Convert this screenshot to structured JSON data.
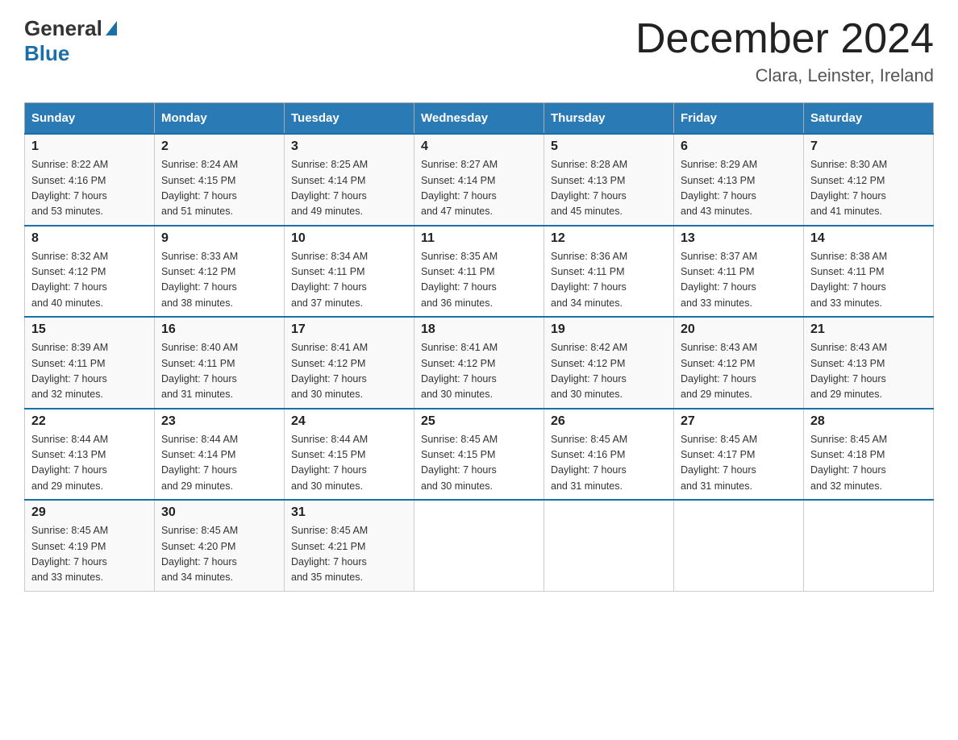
{
  "header": {
    "logo_general": "General",
    "logo_blue": "Blue",
    "month_title": "December 2024",
    "location": "Clara, Leinster, Ireland"
  },
  "days_of_week": [
    "Sunday",
    "Monday",
    "Tuesday",
    "Wednesday",
    "Thursday",
    "Friday",
    "Saturday"
  ],
  "weeks": [
    [
      {
        "day": "1",
        "sunrise": "8:22 AM",
        "sunset": "4:16 PM",
        "daylight": "7 hours and 53 minutes."
      },
      {
        "day": "2",
        "sunrise": "8:24 AM",
        "sunset": "4:15 PM",
        "daylight": "7 hours and 51 minutes."
      },
      {
        "day": "3",
        "sunrise": "8:25 AM",
        "sunset": "4:14 PM",
        "daylight": "7 hours and 49 minutes."
      },
      {
        "day": "4",
        "sunrise": "8:27 AM",
        "sunset": "4:14 PM",
        "daylight": "7 hours and 47 minutes."
      },
      {
        "day": "5",
        "sunrise": "8:28 AM",
        "sunset": "4:13 PM",
        "daylight": "7 hours and 45 minutes."
      },
      {
        "day": "6",
        "sunrise": "8:29 AM",
        "sunset": "4:13 PM",
        "daylight": "7 hours and 43 minutes."
      },
      {
        "day": "7",
        "sunrise": "8:30 AM",
        "sunset": "4:12 PM",
        "daylight": "7 hours and 41 minutes."
      }
    ],
    [
      {
        "day": "8",
        "sunrise": "8:32 AM",
        "sunset": "4:12 PM",
        "daylight": "7 hours and 40 minutes."
      },
      {
        "day": "9",
        "sunrise": "8:33 AM",
        "sunset": "4:12 PM",
        "daylight": "7 hours and 38 minutes."
      },
      {
        "day": "10",
        "sunrise": "8:34 AM",
        "sunset": "4:11 PM",
        "daylight": "7 hours and 37 minutes."
      },
      {
        "day": "11",
        "sunrise": "8:35 AM",
        "sunset": "4:11 PM",
        "daylight": "7 hours and 36 minutes."
      },
      {
        "day": "12",
        "sunrise": "8:36 AM",
        "sunset": "4:11 PM",
        "daylight": "7 hours and 34 minutes."
      },
      {
        "day": "13",
        "sunrise": "8:37 AM",
        "sunset": "4:11 PM",
        "daylight": "7 hours and 33 minutes."
      },
      {
        "day": "14",
        "sunrise": "8:38 AM",
        "sunset": "4:11 PM",
        "daylight": "7 hours and 33 minutes."
      }
    ],
    [
      {
        "day": "15",
        "sunrise": "8:39 AM",
        "sunset": "4:11 PM",
        "daylight": "7 hours and 32 minutes."
      },
      {
        "day": "16",
        "sunrise": "8:40 AM",
        "sunset": "4:11 PM",
        "daylight": "7 hours and 31 minutes."
      },
      {
        "day": "17",
        "sunrise": "8:41 AM",
        "sunset": "4:12 PM",
        "daylight": "7 hours and 30 minutes."
      },
      {
        "day": "18",
        "sunrise": "8:41 AM",
        "sunset": "4:12 PM",
        "daylight": "7 hours and 30 minutes."
      },
      {
        "day": "19",
        "sunrise": "8:42 AM",
        "sunset": "4:12 PM",
        "daylight": "7 hours and 30 minutes."
      },
      {
        "day": "20",
        "sunrise": "8:43 AM",
        "sunset": "4:12 PM",
        "daylight": "7 hours and 29 minutes."
      },
      {
        "day": "21",
        "sunrise": "8:43 AM",
        "sunset": "4:13 PM",
        "daylight": "7 hours and 29 minutes."
      }
    ],
    [
      {
        "day": "22",
        "sunrise": "8:44 AM",
        "sunset": "4:13 PM",
        "daylight": "7 hours and 29 minutes."
      },
      {
        "day": "23",
        "sunrise": "8:44 AM",
        "sunset": "4:14 PM",
        "daylight": "7 hours and 29 minutes."
      },
      {
        "day": "24",
        "sunrise": "8:44 AM",
        "sunset": "4:15 PM",
        "daylight": "7 hours and 30 minutes."
      },
      {
        "day": "25",
        "sunrise": "8:45 AM",
        "sunset": "4:15 PM",
        "daylight": "7 hours and 30 minutes."
      },
      {
        "day": "26",
        "sunrise": "8:45 AM",
        "sunset": "4:16 PM",
        "daylight": "7 hours and 31 minutes."
      },
      {
        "day": "27",
        "sunrise": "8:45 AM",
        "sunset": "4:17 PM",
        "daylight": "7 hours and 31 minutes."
      },
      {
        "day": "28",
        "sunrise": "8:45 AM",
        "sunset": "4:18 PM",
        "daylight": "7 hours and 32 minutes."
      }
    ],
    [
      {
        "day": "29",
        "sunrise": "8:45 AM",
        "sunset": "4:19 PM",
        "daylight": "7 hours and 33 minutes."
      },
      {
        "day": "30",
        "sunrise": "8:45 AM",
        "sunset": "4:20 PM",
        "daylight": "7 hours and 34 minutes."
      },
      {
        "day": "31",
        "sunrise": "8:45 AM",
        "sunset": "4:21 PM",
        "daylight": "7 hours and 35 minutes."
      },
      null,
      null,
      null,
      null
    ]
  ],
  "labels": {
    "sunrise": "Sunrise:",
    "sunset": "Sunset:",
    "daylight": "Daylight:"
  }
}
